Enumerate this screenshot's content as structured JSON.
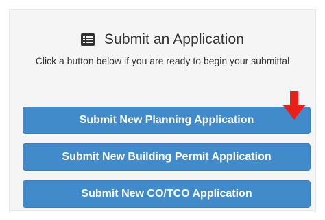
{
  "panel": {
    "icon": "list-icon",
    "title": "Submit an Application",
    "subtitle": "Click a button below if you are ready to begin your submittal"
  },
  "buttons": [
    {
      "label": "Submit New Planning Application"
    },
    {
      "label": "Submit New Building Permit Application"
    },
    {
      "label": "Submit New CO/TCO Application"
    }
  ],
  "annotation": {
    "icon": "down-arrow-icon",
    "color": "#e8201c"
  },
  "colors": {
    "button_bg": "#428bca",
    "panel_bg": "#f5f5f5"
  }
}
